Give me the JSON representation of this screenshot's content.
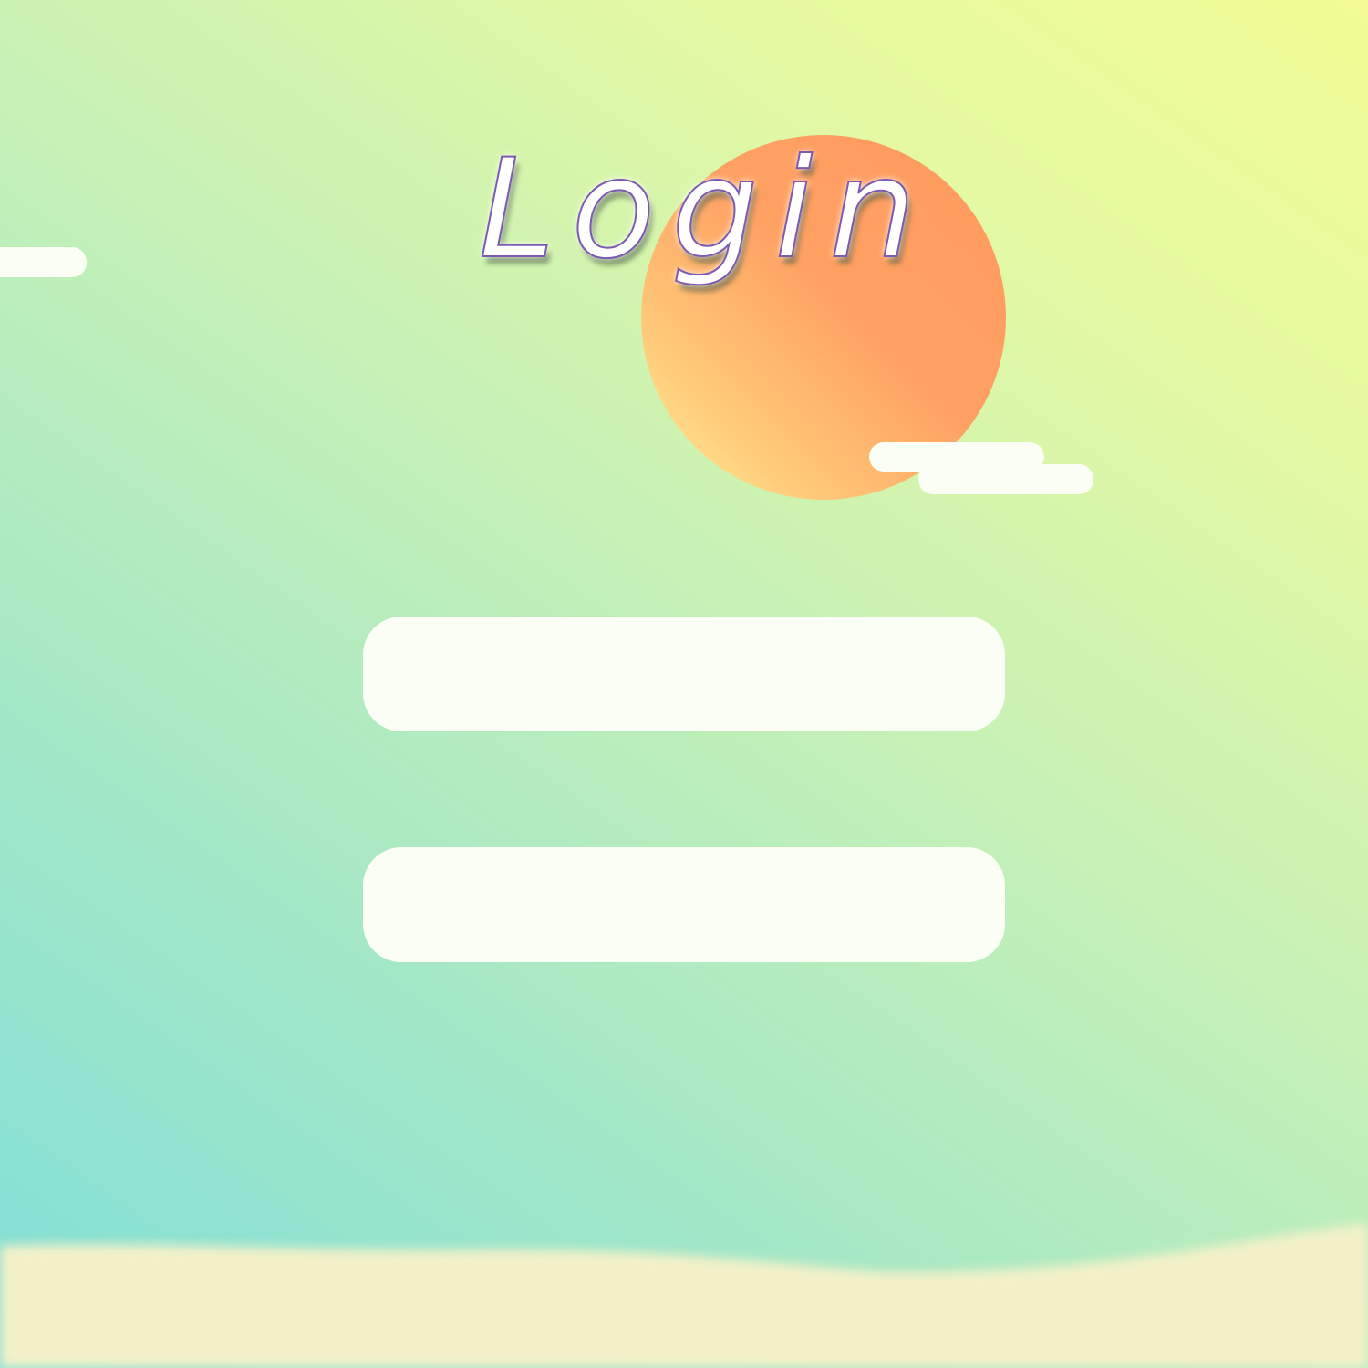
{
  "page": {
    "title": "Login"
  },
  "form": {
    "username": {
      "value": "",
      "placeholder": ""
    },
    "password": {
      "value": "",
      "placeholder": ""
    }
  },
  "colors": {
    "background_start": "#7fdfd8",
    "background_end": "#f2fb93",
    "sun_start": "#fff29b",
    "sun_end": "#ff9a5d",
    "cloud": "#fbfef4",
    "sand": "#f3f0c8",
    "field": "#fbfef4",
    "title_outline": "#7a5ab3"
  },
  "icons": {
    "sun": "sun-icon",
    "cloud": "cloud-icon"
  }
}
